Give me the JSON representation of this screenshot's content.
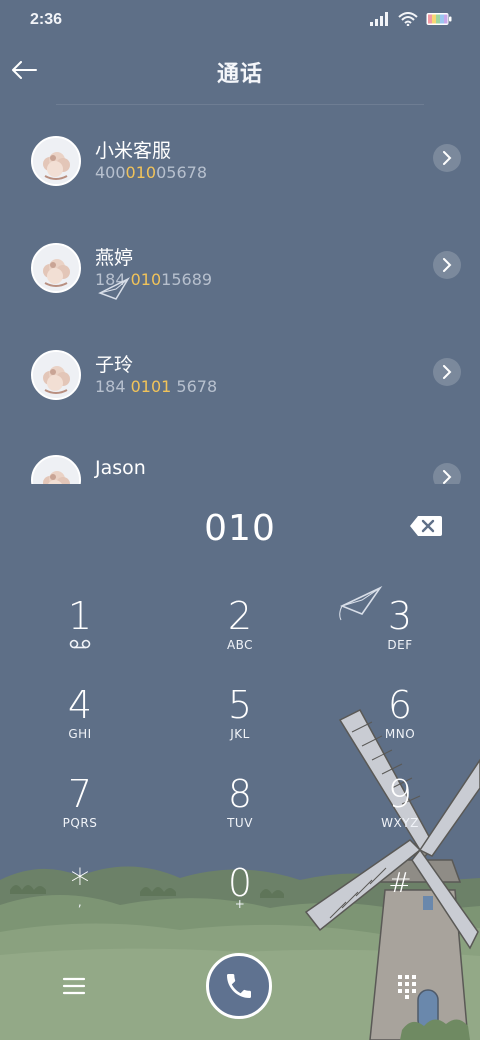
{
  "status_bar": {
    "time": "2:36"
  },
  "header": {
    "title": "通话"
  },
  "contacts": [
    {
      "name": "小米客服",
      "number_parts": [
        "400",
        "010",
        "05678"
      ]
    },
    {
      "name": "燕婷",
      "number_parts": [
        "184 ",
        "010",
        "15689"
      ]
    },
    {
      "name": "子玲",
      "number_parts": [
        "184 ",
        "0101",
        " 5678"
      ]
    },
    {
      "name": "Jason",
      "number_parts": [
        "",
        "",
        ""
      ]
    }
  ],
  "dial": {
    "entered_number": "010"
  },
  "keypad": [
    {
      "digit": "1",
      "letters": ""
    },
    {
      "digit": "2",
      "letters": "ABC"
    },
    {
      "digit": "3",
      "letters": "DEF"
    },
    {
      "digit": "4",
      "letters": "GHI"
    },
    {
      "digit": "5",
      "letters": "JKL"
    },
    {
      "digit": "6",
      "letters": "MNO"
    },
    {
      "digit": "7",
      "letters": "PQRS"
    },
    {
      "digit": "8",
      "letters": "TUV"
    },
    {
      "digit": "9",
      "letters": "WXYZ"
    },
    {
      "digit": "*",
      "letters": ","
    },
    {
      "digit": "0",
      "letters": "+"
    },
    {
      "digit": "#",
      "letters": ""
    }
  ],
  "icons": {
    "back": "back-arrow-icon",
    "chevron": "chevron-right-icon",
    "backspace": "backspace-icon",
    "voicemail": "voicemail-icon",
    "menu": "menu-icon",
    "call": "phone-icon",
    "dialpad": "dialpad-icon",
    "signal": "signal-icon",
    "wifi": "wifi-icon",
    "battery": "battery-icon"
  },
  "colors": {
    "background": "#5e6f87",
    "highlight": "#f1c35a",
    "number_text": "#b7c0ce",
    "call_button": "#5f7290"
  }
}
